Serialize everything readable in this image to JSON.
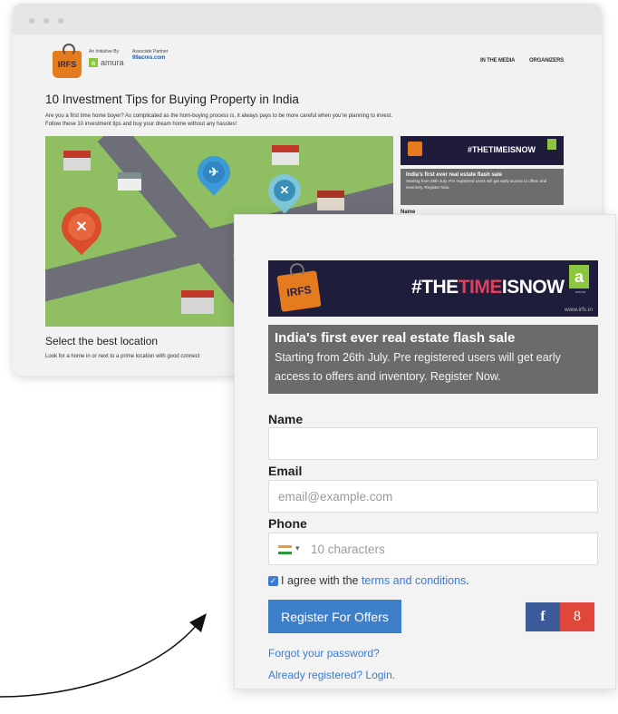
{
  "back_page": {
    "initiative_label": "An Initiative By",
    "initiative_brand": "amura",
    "partner_label": "Associate Partner",
    "partner_brand": "99acres.com",
    "logo_text": "IRFS",
    "nav": [
      "IN THE MEDIA",
      "ORGANIZERS"
    ],
    "article_title": "10 Investment Tips for Buying Property in India",
    "article_intro": "Are you a first time home buyer? As complicated as the hom-buying process is, it always pays to be more careful when you're planning to invest. Follow these 10 investment tips and buy your dream home without any hassles!",
    "section_heading": "Select the best location",
    "section_text": "Look for a home in or next to a prime location with good connect",
    "mini_banner": "#THETIMEISNOW",
    "mini_flash_title": "India's first ever real estate flash sale",
    "mini_flash_body": "Starting from 26th July. Pre registered users will get early access to offers and inventory. Register Now.",
    "mini_name_label": "Name"
  },
  "form": {
    "logo_text": "IRFS",
    "hashtag_pre": "#THE",
    "hashtag_hl": "TIME",
    "hashtag_post": "ISNOW",
    "amura_letter": "a",
    "amura_sub": "amura",
    "site_url": "www.irfs.in",
    "flash_title": "India's first ever real estate flash sale",
    "flash_body": "Starting from 26th July. Pre registered users will get early access to offers and inventory. Register Now.",
    "name_label": "Name",
    "name_value": "",
    "email_label": "Email",
    "email_placeholder": "email@example.com",
    "phone_label": "Phone",
    "phone_placeholder": "10 characters",
    "agree_prefix": "I agree with the ",
    "terms_link": "terms and conditions",
    "agree_suffix": ".",
    "register_button": "Register For Offers",
    "facebook_glyph": "f",
    "google_glyph": "8",
    "forgot_link": "Forgot your password?",
    "login_link": "Already registered? Login."
  },
  "colors": {
    "banner_bg": "#1f1d3c",
    "flash_bg": "#6b6b6b",
    "button_blue": "#3e7fca",
    "link_blue": "#3a7bd5",
    "facebook": "#3c5a9a",
    "google": "#e0463a",
    "accent_green": "#8cc63f",
    "accent_orange": "#e67a1e"
  },
  "icons": {
    "window_dots": [
      "window-dot-icon",
      "window-dot-icon",
      "window-dot-icon"
    ],
    "pins": [
      "restaurant-pin-icon",
      "airport-pin-icon",
      "tools-pin-icon"
    ],
    "checkbox": "checkmark-icon",
    "flag": "india-flag-icon",
    "arrow": "curved-arrow-icon"
  }
}
